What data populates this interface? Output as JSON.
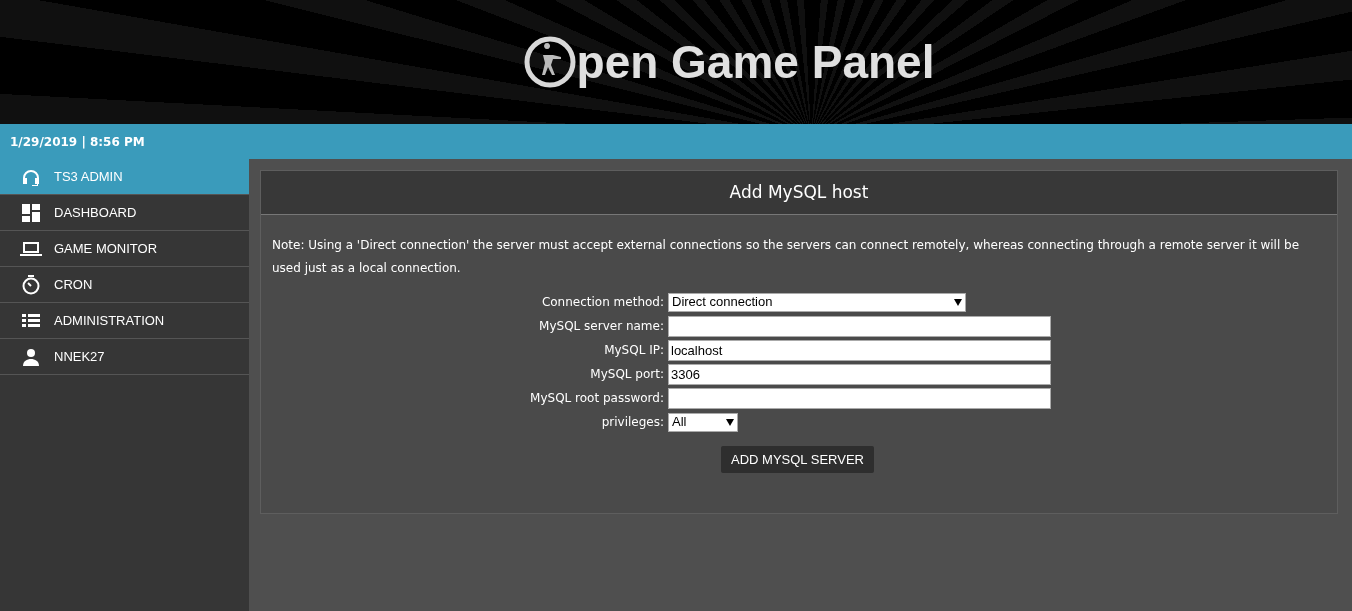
{
  "header": {
    "logo_text": "pen Game Panel"
  },
  "date_bar": {
    "datetime": "1/29/2019 | 8:56 PM"
  },
  "sidebar": {
    "items": [
      {
        "label": "TS3 ADMIN",
        "selected": true
      },
      {
        "label": "DASHBOARD",
        "selected": false
      },
      {
        "label": "GAME MONITOR",
        "selected": false
      },
      {
        "label": "CRON",
        "selected": false
      },
      {
        "label": "ADMINISTRATION",
        "selected": false
      },
      {
        "label": "NNEK27",
        "selected": false
      }
    ]
  },
  "panel": {
    "title": "Add MySQL host",
    "note": "Note: Using a 'Direct connection' the server must accept external connections so the servers can connect remotely, whereas connecting through a remote server it will be used just as a local connection.",
    "fields": [
      {
        "label": "Connection method:",
        "kind": "select",
        "value": "Direct connection"
      },
      {
        "label": "MySQL server name:",
        "kind": "text"
      },
      {
        "label": "MySQL IP:",
        "kind": "text",
        "value": "localhost"
      },
      {
        "label": "MySQL port:",
        "kind": "text",
        "value": "3306"
      },
      {
        "label": "MySQL root password:",
        "kind": "text"
      },
      {
        "label": "privileges:",
        "kind": "select",
        "value": "All"
      }
    ],
    "submit": "ADD MYSQL SERVER"
  }
}
